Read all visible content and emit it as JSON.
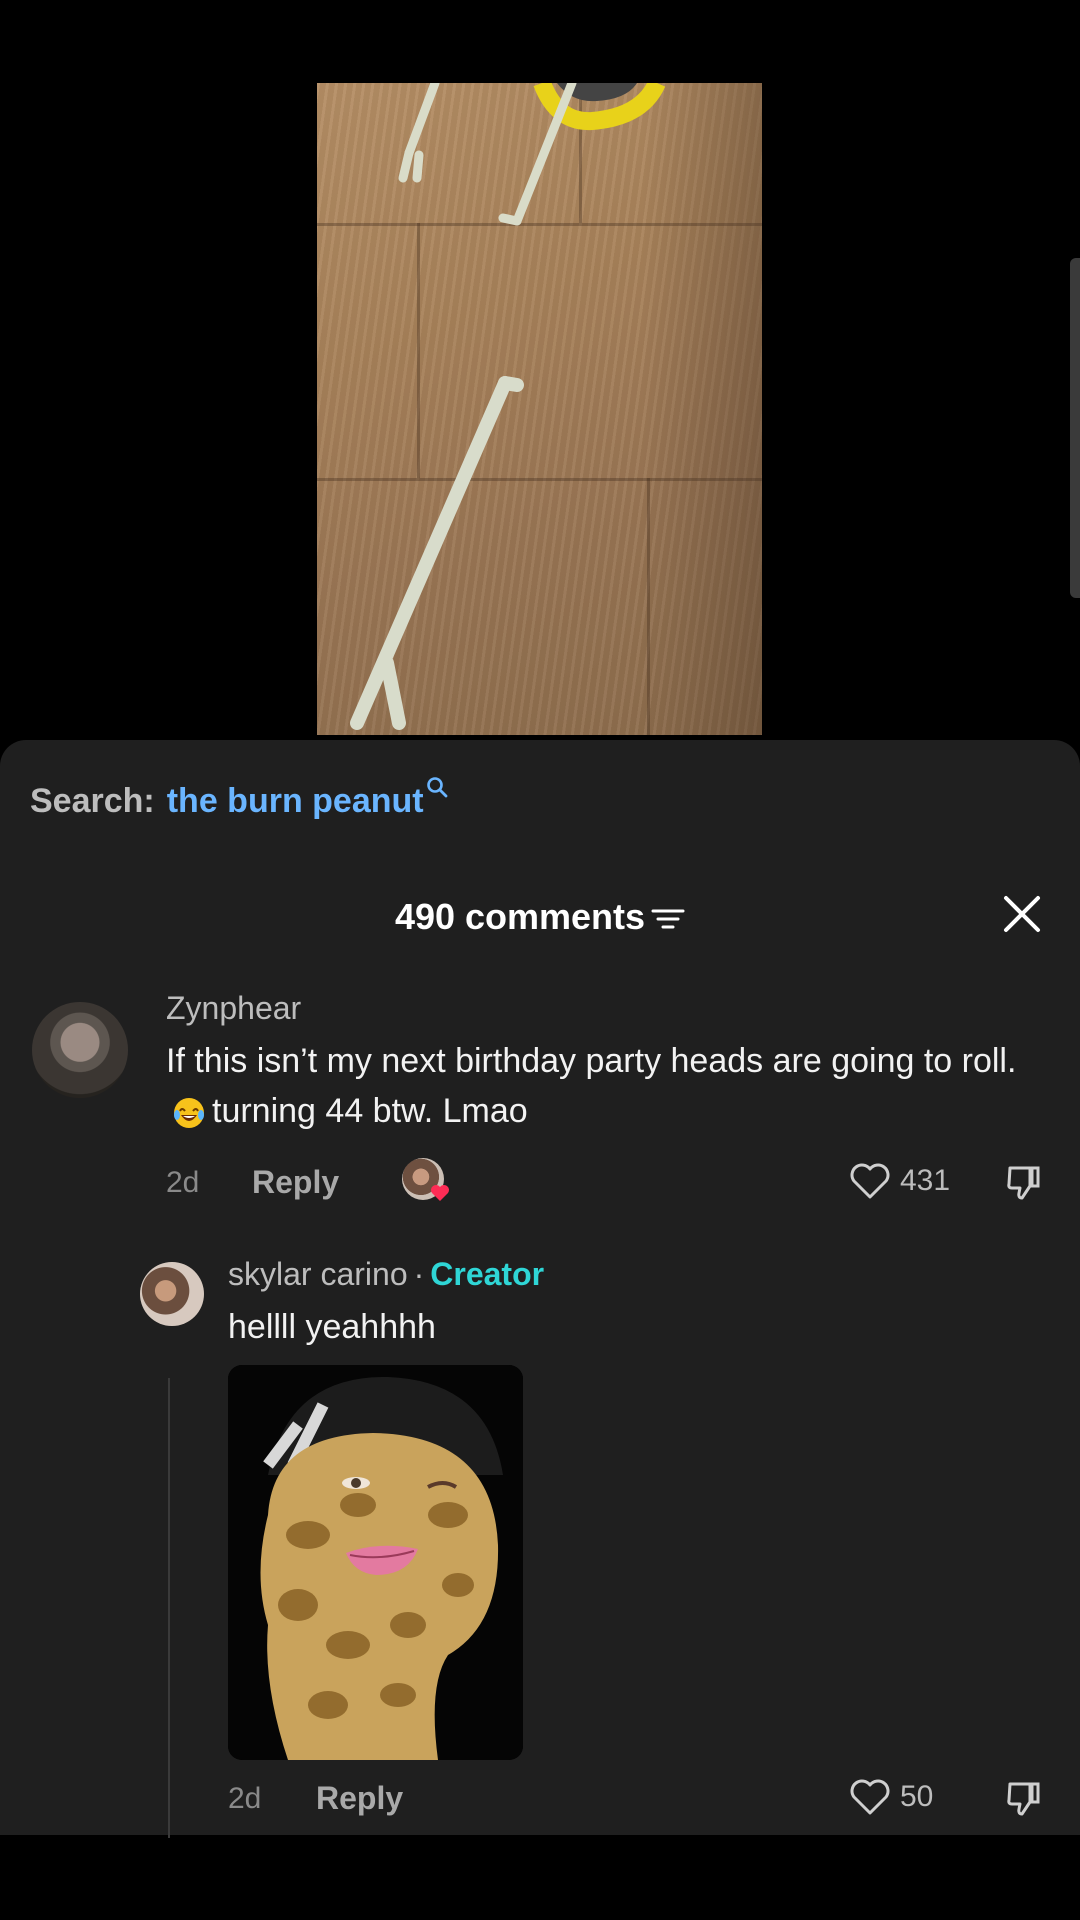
{
  "search": {
    "prefix": "Search:",
    "term": "the burn peanut"
  },
  "comments_header": {
    "count_label": "490 comments"
  },
  "comments": [
    {
      "author": "Zynphear",
      "text_before_emoji": "If this isn’t my next birthday party heads are going to roll.",
      "emoji": "laughing-tears-emoji",
      "text_after_emoji": "turning 44 btw. Lmao",
      "time": "2d",
      "reply_label": "Reply",
      "likes": "431"
    }
  ],
  "reply": {
    "author": "skylar carino",
    "separator": "·",
    "badge": "Creator",
    "text": "hellll yeahhhh",
    "time": "2d",
    "reply_label": "Reply",
    "likes": "50",
    "attachment": "peanut-face-sticker"
  },
  "colors": {
    "sheet_bg": "#1f1f1f",
    "search_term": "#6ab5ff",
    "creator_badge": "#2fd6d6",
    "heart_badge": "#fe2c55"
  }
}
